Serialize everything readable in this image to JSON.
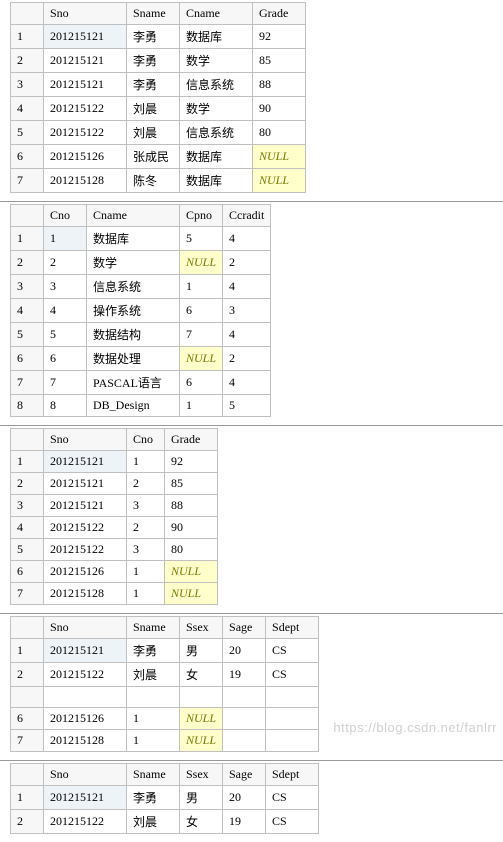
{
  "table1": {
    "headers": [
      "Sno",
      "Sname",
      "Cname",
      "Grade"
    ],
    "rows": [
      {
        "n": "1",
        "c": [
          "201215121",
          "李勇",
          "数据库",
          "92"
        ],
        "sel": true
      },
      {
        "n": "2",
        "c": [
          "201215121",
          "李勇",
          "数学",
          "85"
        ]
      },
      {
        "n": "3",
        "c": [
          "201215121",
          "李勇",
          "信息系统",
          "88"
        ]
      },
      {
        "n": "4",
        "c": [
          "201215122",
          "刘晨",
          "数学",
          "90"
        ]
      },
      {
        "n": "5",
        "c": [
          "201215122",
          "刘晨",
          "信息系统",
          "80"
        ]
      },
      {
        "n": "6",
        "c": [
          "201215126",
          "张成民",
          "数据库",
          "NULL"
        ],
        "nullcols": [
          3
        ]
      },
      {
        "n": "7",
        "c": [
          "201215128",
          "陈冬",
          "数据库",
          "NULL"
        ],
        "nullcols": [
          3
        ]
      }
    ],
    "widths": [
      70,
      40,
      60,
      40
    ]
  },
  "table2": {
    "headers": [
      "Cno",
      "Cname",
      "Cpno",
      "Ccradit"
    ],
    "rows": [
      {
        "n": "1",
        "c": [
          "1",
          "数据库",
          "5",
          "4"
        ],
        "sel": true
      },
      {
        "n": "2",
        "c": [
          "2",
          "数学",
          "NULL",
          "2"
        ],
        "nullcols": [
          2
        ]
      },
      {
        "n": "3",
        "c": [
          "3",
          "信息系统",
          "1",
          "4"
        ]
      },
      {
        "n": "4",
        "c": [
          "4",
          "操作系统",
          "6",
          "3"
        ]
      },
      {
        "n": "5",
        "c": [
          "5",
          "数据结构",
          "7",
          "4"
        ]
      },
      {
        "n": "6",
        "c": [
          "6",
          "数据处理",
          "NULL",
          "2"
        ],
        "nullcols": [
          2
        ]
      },
      {
        "n": "7",
        "c": [
          "7",
          "PASCAL语言",
          "6",
          "4"
        ]
      },
      {
        "n": "8",
        "c": [
          "8",
          "DB_Design",
          "1",
          "5"
        ]
      }
    ],
    "widths": [
      30,
      80,
      30,
      30
    ]
  },
  "table3": {
    "headers": [
      "Sno",
      "Cno",
      "Grade"
    ],
    "rows": [
      {
        "n": "1",
        "c": [
          "201215121",
          "1",
          "92"
        ],
        "sel": true
      },
      {
        "n": "2",
        "c": [
          "201215121",
          "2",
          "85"
        ]
      },
      {
        "n": "3",
        "c": [
          "201215121",
          "3",
          "88"
        ]
      },
      {
        "n": "4",
        "c": [
          "201215122",
          "2",
          "90"
        ]
      },
      {
        "n": "5",
        "c": [
          "201215122",
          "3",
          "80"
        ]
      },
      {
        "n": "6",
        "c": [
          "201215126",
          "1",
          "NULL"
        ],
        "nullcols": [
          2
        ]
      },
      {
        "n": "7",
        "c": [
          "201215128",
          "1",
          "NULL"
        ],
        "nullcols": [
          2
        ]
      }
    ],
    "widths": [
      70,
      25,
      40
    ]
  },
  "table4": {
    "headers": [
      "Sno",
      "Sname",
      "Ssex",
      "Sage",
      "Sdept"
    ],
    "rows": [
      {
        "n": "1",
        "c": [
          "201215121",
          "李勇",
          "男",
          "20",
          "CS"
        ],
        "sel": true
      },
      {
        "n": "2",
        "c": [
          "201215122",
          "刘晨",
          "女",
          "19",
          "CS"
        ]
      },
      {
        "n": "",
        "c": [
          "",
          "",
          "",
          "",
          ""
        ]
      },
      {
        "n": "6",
        "c": [
          "201215126",
          "1",
          "NULL",
          "",
          ""
        ],
        "nullcols": [
          2
        ]
      },
      {
        "n": "7",
        "c": [
          "201215128",
          "1",
          "NULL",
          "",
          ""
        ],
        "nullcols": [
          2
        ]
      }
    ],
    "widths": [
      70,
      40,
      30,
      30,
      40
    ]
  },
  "table5": {
    "headers": [
      "Sno",
      "Sname",
      "Ssex",
      "Sage",
      "Sdept"
    ],
    "rows": [
      {
        "n": "1",
        "c": [
          "201215121",
          "李勇",
          "男",
          "20",
          "CS"
        ],
        "sel": true
      },
      {
        "n": "2",
        "c": [
          "201215122",
          "刘晨",
          "女",
          "19",
          "CS"
        ]
      }
    ],
    "widths": [
      70,
      40,
      30,
      30,
      40
    ]
  },
  "watermark": "https://blog.csdn.net/fanlrr"
}
